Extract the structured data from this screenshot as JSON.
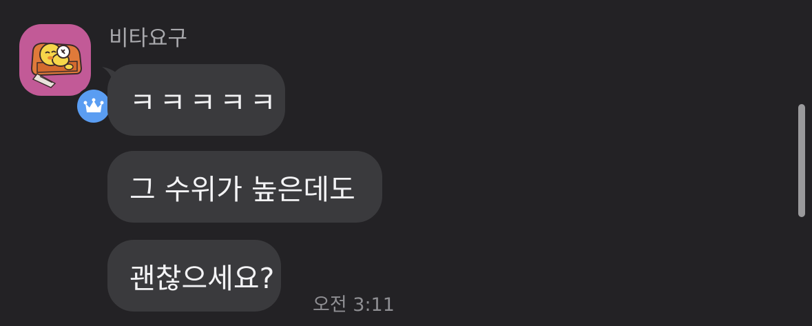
{
  "chat": {
    "sender_name": "비타요구",
    "messages": [
      {
        "text": "ㅋㅋㅋㅋㅋ"
      },
      {
        "text": "그 수위가 높은데도"
      },
      {
        "text": "괜찮으세요?"
      }
    ],
    "timestamp": "오전 3:11"
  },
  "avatar": {
    "background_color": "#c25a97",
    "badge": "crown-icon",
    "badge_color": "#5a9df2"
  },
  "colors": {
    "background": "#232225",
    "bubble": "#3a3a3d",
    "name_text": "#a9a9ad",
    "timestamp_text": "#8f8f93"
  }
}
